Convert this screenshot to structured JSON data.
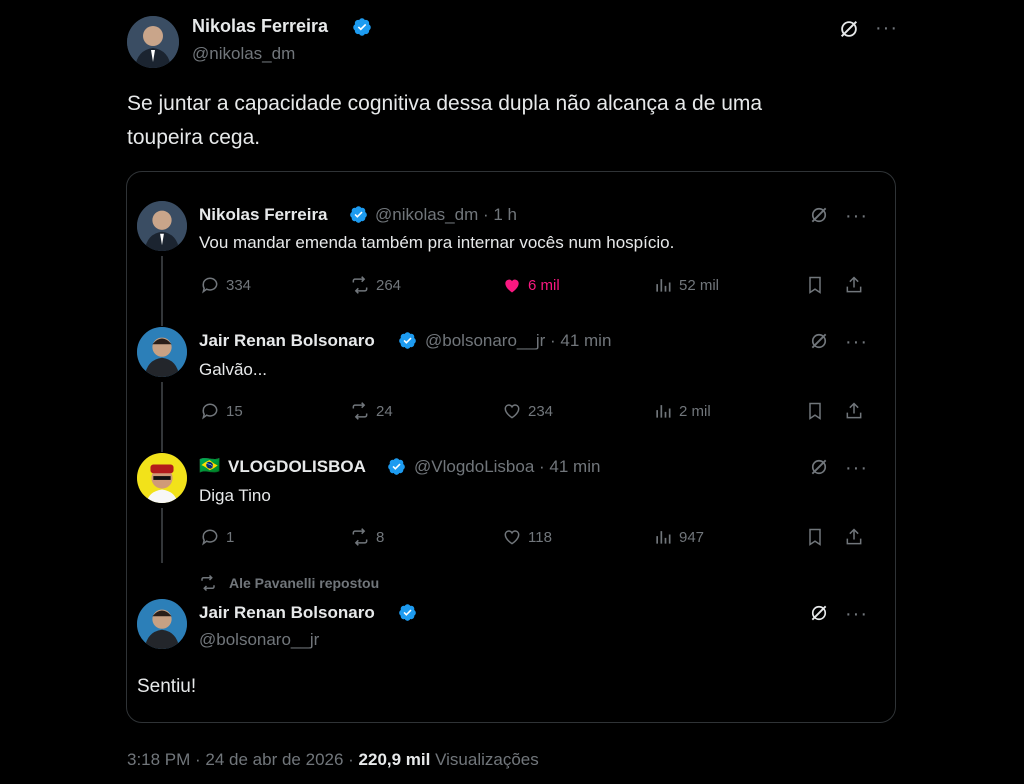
{
  "main_post": {
    "author_name": "Nikolas Ferreira",
    "author_handle": "@nikolas_dm",
    "text_line1": "Se juntar a capacidade cognitiva dessa dupla não alcança a de uma",
    "text_line2": "toupeira cega.",
    "timestamp": "3:18 PM · 24 de abr de 2026 ·",
    "views_count": "220,9 mil",
    "views_label": "Visualizações"
  },
  "quoted_thread": [
    {
      "author_name": "Nikolas Ferreira",
      "author_handle": "@nikolas_dm · 1 h",
      "text": "Vou mandar emenda também pra internar vocês num hospício.",
      "replies": "334",
      "reposts": "264",
      "likes": "6 mil",
      "views": "52 mil"
    },
    {
      "author_name": "Jair Renan Bolsonaro",
      "author_handle": "@bolsonaro__jr · 41 min",
      "text": "Galvão...",
      "replies": "15",
      "reposts": "24",
      "likes": "234",
      "views": "2 mil"
    },
    {
      "author_name": "VLOGDOLISBOA",
      "flag": "🇧🇷",
      "author_handle": "@VlogdoLisboa · 41 min",
      "text": "Diga Tino",
      "replies": "1",
      "reposts": "8",
      "likes": "118",
      "views": "947"
    }
  ],
  "repost_notice": "Ale Pavanelli repostou",
  "final_post": {
    "author_name": "Jair Renan Bolsonaro",
    "author_handle": "@bolsonaro__jr",
    "text": "Sentiu!"
  },
  "colors": {
    "background": "#000000",
    "text": "#e7e9ea",
    "muted": "#71767b",
    "verified": "#1d9bf0",
    "like_active": "#f91880"
  }
}
